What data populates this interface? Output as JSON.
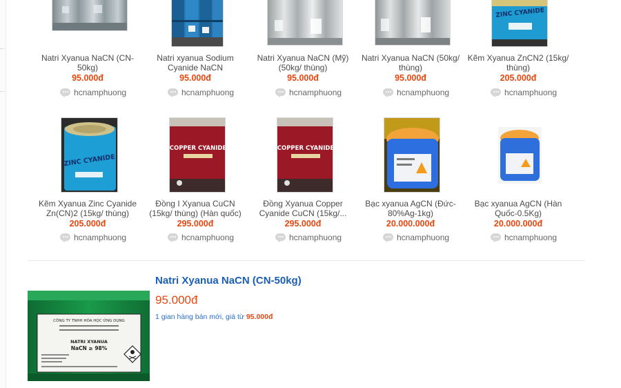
{
  "shop_label": "hcnamphuong",
  "row1": [
    {
      "name": "Natri Xyanua NaCN (CN-50kg)",
      "price": "95.000đ",
      "thumb": "grey-drums"
    },
    {
      "name": "Natri xyanua Sodium Cyanide NaCN",
      "price": "95.000đ",
      "thumb": "blue-drums"
    },
    {
      "name": "Natri Xyanua NaCN (Mỹ) (50kg/ thùng)",
      "price": "95.000đ",
      "thumb": "white-drums"
    },
    {
      "name": "Natri Xyanua NaCN (50kg/ thùng)",
      "price": "95.000đ",
      "thumb": "white-drums"
    },
    {
      "name": "Kẽm Xyanua ZnCN2 (15kg/ thùng)",
      "price": "205.000đ",
      "thumb": "zinc-can"
    }
  ],
  "row2": [
    {
      "name": "Kẽm Xyanua Zinc Cyanide Zn(CN)2 (15kg/ thùng)",
      "price": "205.000đ",
      "thumb": "zinc-can",
      "can_label": "ZINC CYANIDE"
    },
    {
      "name": "Đồng I Xyanua CuCN (15kg/ thùng) (Hàn quốc)",
      "price": "295.000đ",
      "thumb": "copper-can",
      "can_label": "COPPER CYANIDE"
    },
    {
      "name": "Đồng Xyanua Copper Cyanide CuCN (15kg/...",
      "price": "295.000đ",
      "thumb": "copper-can",
      "can_label": "COPPER CYANIDE"
    },
    {
      "name": "Bạc xyanua AgCN (Đức-80%Ag-1kg)",
      "price": "20.000.000đ",
      "thumb": "blue-jar"
    },
    {
      "name": "Bạc xyanua AgCN (Hàn Quốc-0.5Kg)",
      "price": "20.000.000đ",
      "thumb": "blue-jar-small"
    }
  ],
  "featured": {
    "title": "Natri Xyanua NaCN (CN-50kg)",
    "price": "95.000đ",
    "note_prefix": "1 gian hàng bán mới, giá từ ",
    "note_price": "95.000đ",
    "label_company": "CÔNG TY TNHH HÓA HỌC ỨNG DỤNG",
    "label_product": "NATRI XYANUA",
    "label_formula": "NaCN ≥ 98%"
  },
  "colors": {
    "price": "#e8470f",
    "link": "#1a5fb4"
  }
}
